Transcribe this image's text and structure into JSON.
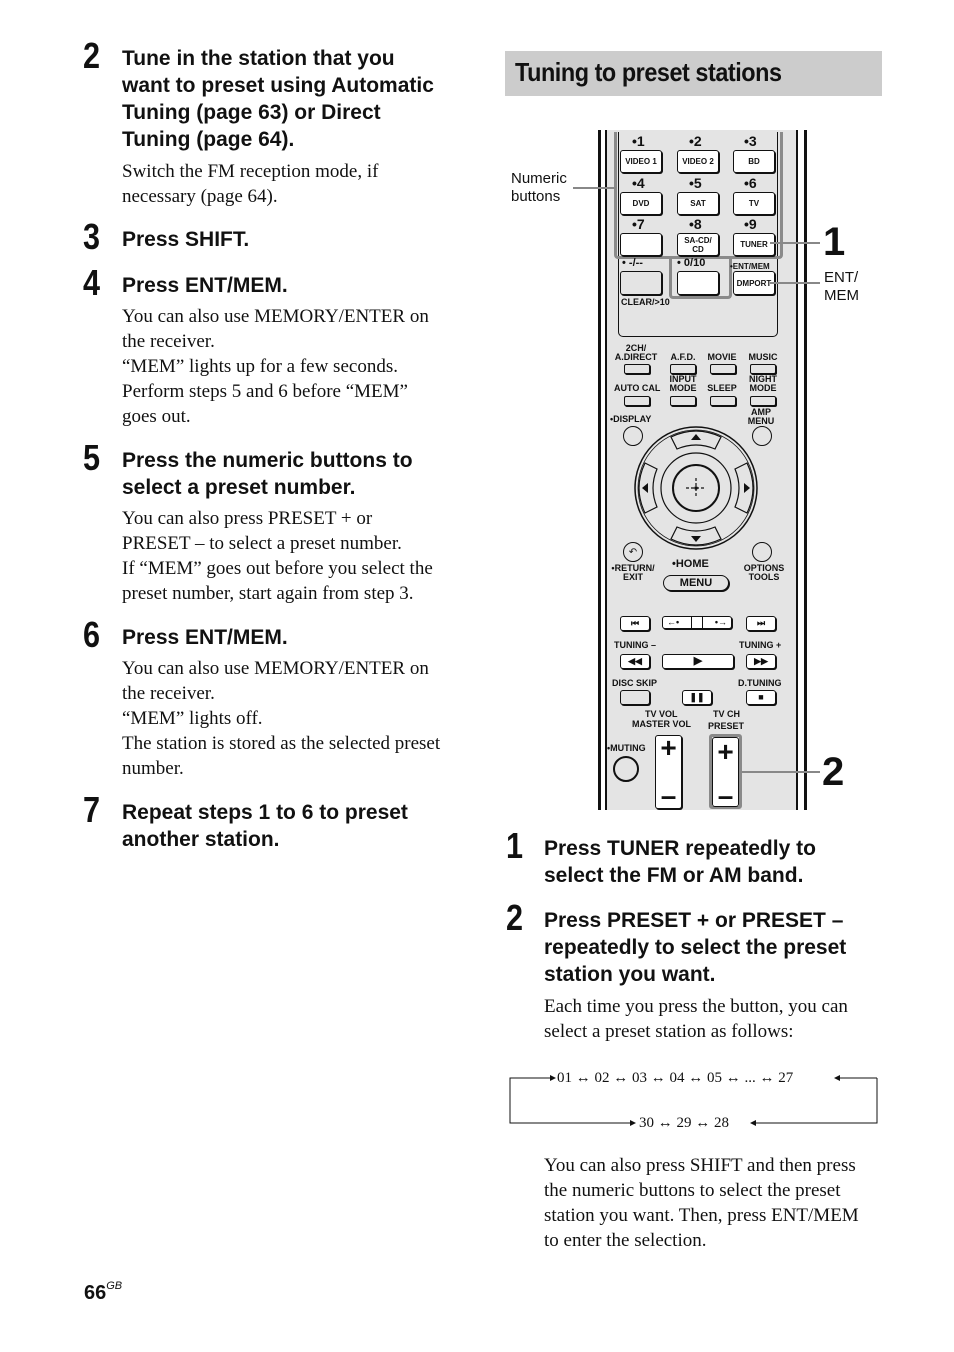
{
  "left_steps": [
    {
      "number": "2",
      "heading": [
        "Tune in the station that you",
        "want to preset using Automatic",
        "Tuning (page 63) or Direct",
        "Tuning (page 64)."
      ],
      "body": [
        "Switch the FM reception mode, if",
        "necessary (page 64)."
      ]
    },
    {
      "number": "3",
      "heading": [
        "Press SHIFT."
      ],
      "body": []
    },
    {
      "number": "4",
      "heading": [
        "Press ENT/MEM."
      ],
      "body": [
        "You can also use MEMORY/ENTER on",
        "the receiver.",
        "“MEM” lights up for a few seconds.",
        "Perform steps 5 and 6 before “MEM”",
        "goes out."
      ]
    },
    {
      "number": "5",
      "heading": [
        "Press the numeric buttons to",
        "select a preset number."
      ],
      "body": [
        "You can also press PRESET + or",
        "PRESET – to select a preset number.",
        "If “MEM” goes out before you select the",
        "preset number, start again from step 3."
      ]
    },
    {
      "number": "6",
      "heading": [
        "Press ENT/MEM."
      ],
      "body": [
        "You can also use MEMORY/ENTER on",
        "the receiver.",
        "“MEM” lights off.",
        "The station is stored as the selected preset",
        "number."
      ]
    },
    {
      "number": "7",
      "heading": [
        "Repeat steps 1 to 6 to preset",
        "another station."
      ],
      "body": []
    }
  ],
  "section_title": "Tuning to preset stations",
  "figure": {
    "callouts": {
      "numeric_buttons": [
        "Numeric",
        "buttons"
      ],
      "one": "1",
      "ent_mem": [
        "ENT/",
        "MEM"
      ],
      "two": "2"
    },
    "remote": {
      "numbers": [
        "•1",
        "•2",
        "•3",
        "•4",
        "•5",
        "•6",
        "•7",
        "•8",
        "•9"
      ],
      "num_buttons": [
        "VIDEO 1",
        "VIDEO 2",
        "BD",
        "DVD",
        "SAT",
        "TV",
        "",
        "SA-CD/ CD",
        "TUNER"
      ],
      "dash": "• -/--",
      "zero": "• 0/10",
      "entmem": "•ENT/MEM",
      "dmport": "DMPORT",
      "clear": "CLEAR/>10",
      "row1": [
        "2CH/ A.DIRECT",
        "A.F.D.",
        "MOVIE",
        "MUSIC"
      ],
      "row2": [
        "AUTO CAL",
        "INPUT MODE",
        "SLEEP",
        "NIGHT MODE"
      ],
      "display": "•DISPLAY",
      "amp_menu": "AMP MENU",
      "return_exit": "•RETURN/ EXIT",
      "home": "•HOME",
      "menu": "MENU",
      "options_tools": "OPTIONS TOOLS",
      "tuning_minus": "TUNING –",
      "tuning_plus": "TUNING +",
      "disc_skip": "DISC SKIP",
      "d_tuning": "D.TUNING",
      "tv_vol": "TV VOL",
      "master_vol": "MASTER VOL",
      "tv_ch": "TV CH",
      "preset": "PRESET",
      "muting": "•MUTING",
      "plus": "+",
      "minus": "–"
    }
  },
  "right_steps": [
    {
      "number": "1",
      "heading": [
        "Press TUNER repeatedly to",
        "select the FM or AM band."
      ],
      "body": []
    },
    {
      "number": "2",
      "heading": [
        "Press PRESET + or PRESET –",
        "repeatedly to select the preset",
        "station you want."
      ],
      "body": [
        "Each time you press the button, you can",
        "select a preset station as follows:"
      ]
    }
  ],
  "preset_sequence": {
    "top": [
      "01",
      "02",
      "03",
      "04",
      "05",
      "...",
      "27"
    ],
    "bottom": [
      "30",
      "29",
      "28"
    ]
  },
  "closing_text": [
    "You can also press SHIFT and then press",
    "the numeric buttons to select the preset",
    "station you want. Then, press ENT/MEM",
    "to enter the selection."
  ],
  "page_number": "66",
  "page_suffix": "GB"
}
